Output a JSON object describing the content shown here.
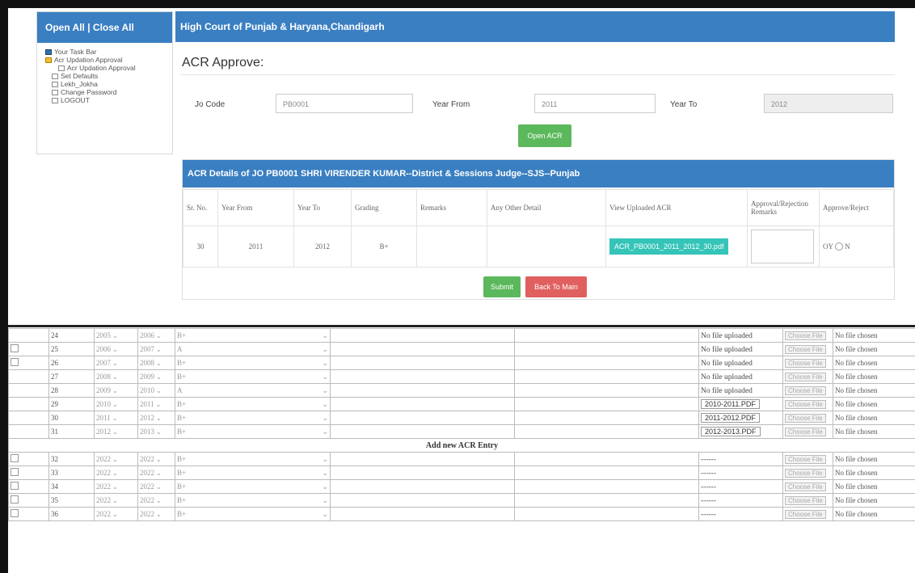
{
  "left_panel": {
    "header": "Open All | Close All",
    "tree": [
      {
        "label": "Your Task Bar",
        "indent": 0,
        "icon": "task"
      },
      {
        "label": "Acr Updation Approval",
        "indent": 0,
        "icon": "folder"
      },
      {
        "label": "Acr Updation Approval",
        "indent": 2,
        "icon": "page"
      },
      {
        "label": "Set Defaults",
        "indent": 1,
        "icon": "page"
      },
      {
        "label": "Lekh_Jokha",
        "indent": 1,
        "icon": "page"
      },
      {
        "label": "Change Password",
        "indent": 1,
        "icon": "page"
      },
      {
        "label": "LOGOUT",
        "indent": 1,
        "icon": "page"
      }
    ]
  },
  "main": {
    "header": "High Court of Punjab & Haryana,Chandigarh",
    "title": "ACR Approve:",
    "jo_code_label": "Jo Code",
    "jo_code_value": "PB0001",
    "year_from_label": "Year From",
    "year_from_value": "2011",
    "year_to_label": "Year To",
    "year_to_value": "2012",
    "open_acr_label": "Open ACR",
    "details_header": "ACR Details of JO PB0001 SHRI VIRENDER KUMAR--District & Sessions Judge--SJS--Punjab",
    "columns": [
      "Sr. No.",
      "Year From",
      "Year To",
      "Grading",
      "Remarks",
      "Any Other Detail",
      "View Uploaded ACR",
      "Approval/Rejection Remarks",
      "Approve/Reject"
    ],
    "row": {
      "sr": "30",
      "year_from": "2011",
      "year_to": "2012",
      "grading": "B+",
      "remarks": "",
      "other": "",
      "file": "ACR_PB0001_2011_2012_30.pdf",
      "approve_option": "OY",
      "reject_option": "N"
    },
    "submit_label": "Submit",
    "back_label": "Back To Main"
  },
  "lower_table": {
    "rows_top": [
      {
        "n": "24",
        "from": "2005",
        "to": "2006",
        "grade": "B+",
        "chk": false,
        "file": "No file uploaded",
        "pdf": false
      },
      {
        "n": "25",
        "from": "2006",
        "to": "2007",
        "grade": "A",
        "chk": true,
        "file": "No file uploaded",
        "pdf": false
      },
      {
        "n": "26",
        "from": "2007",
        "to": "2008",
        "grade": "B+",
        "chk": true,
        "file": "No file uploaded",
        "pdf": false
      },
      {
        "n": "27",
        "from": "2008",
        "to": "2009",
        "grade": "B+",
        "chk": false,
        "file": "No file uploaded",
        "pdf": false
      },
      {
        "n": "28",
        "from": "2009",
        "to": "2010",
        "grade": "A",
        "chk": false,
        "file": "No file uploaded",
        "pdf": false
      },
      {
        "n": "29",
        "from": "2010",
        "to": "2011",
        "grade": "B+",
        "chk": false,
        "file": "2010-2011.PDF",
        "pdf": true
      },
      {
        "n": "30",
        "from": "2011",
        "to": "2012",
        "grade": "B+",
        "chk": false,
        "file": "2011-2012.PDF",
        "pdf": true
      },
      {
        "n": "31",
        "from": "2012",
        "to": "2013",
        "grade": "B+",
        "chk": false,
        "file": "2012-2013.PDF",
        "pdf": true
      }
    ],
    "add_new_label": "Add new ACR Entry",
    "rows_bottom": [
      {
        "n": "32",
        "from": "2022",
        "to": "2022",
        "grade": "B+",
        "chk": true,
        "file": "------"
      },
      {
        "n": "33",
        "from": "2022",
        "to": "2022",
        "grade": "B+",
        "chk": true,
        "file": "------"
      },
      {
        "n": "34",
        "from": "2022",
        "to": "2022",
        "grade": "B+",
        "chk": true,
        "file": "------"
      },
      {
        "n": "35",
        "from": "2022",
        "to": "2022",
        "grade": "B+",
        "chk": true,
        "file": "------"
      },
      {
        "n": "36",
        "from": "2022",
        "to": "2022",
        "grade": "B+",
        "chk": true,
        "file": "------"
      }
    ],
    "choose_file_label": "Choose File",
    "no_file_chosen": "No file chosen"
  },
  "colors": {
    "header_blue": "#3a7fc1",
    "green": "#5cb85c",
    "red": "#e06060",
    "teal": "#35c4b8"
  }
}
